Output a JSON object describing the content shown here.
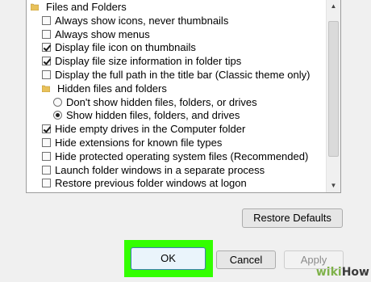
{
  "options_tree": {
    "items": [
      {
        "type": "folder",
        "indent": 0,
        "label": "Files and Folders"
      },
      {
        "type": "checkbox",
        "indent": 1,
        "checked": false,
        "label": "Always show icons, never thumbnails"
      },
      {
        "type": "checkbox",
        "indent": 1,
        "checked": false,
        "label": "Always show menus"
      },
      {
        "type": "checkbox",
        "indent": 1,
        "checked": true,
        "label": "Display file icon on thumbnails"
      },
      {
        "type": "checkbox",
        "indent": 1,
        "checked": true,
        "label": "Display file size information in folder tips"
      },
      {
        "type": "checkbox",
        "indent": 1,
        "checked": false,
        "label": "Display the full path in the title bar (Classic theme only)"
      },
      {
        "type": "folder",
        "indent": 1,
        "label": "Hidden files and folders"
      },
      {
        "type": "radio",
        "indent": 2,
        "checked": false,
        "label": "Don't show hidden files, folders, or drives"
      },
      {
        "type": "radio",
        "indent": 2,
        "checked": true,
        "label": "Show hidden files, folders, and drives"
      },
      {
        "type": "checkbox",
        "indent": 1,
        "checked": true,
        "label": "Hide empty drives in the Computer folder"
      },
      {
        "type": "checkbox",
        "indent": 1,
        "checked": false,
        "label": "Hide extensions for known file types"
      },
      {
        "type": "checkbox",
        "indent": 1,
        "checked": false,
        "label": "Hide protected operating system files (Recommended)"
      },
      {
        "type": "checkbox",
        "indent": 1,
        "checked": false,
        "label": "Launch folder windows in a separate process"
      },
      {
        "type": "checkbox",
        "indent": 1,
        "checked": false,
        "label": "Restore previous folder windows at logon"
      }
    ]
  },
  "buttons": {
    "restore_defaults": "Restore Defaults",
    "ok": "OK",
    "cancel": "Cancel",
    "apply": "Apply"
  },
  "highlight_color": "#33ff00",
  "watermark": {
    "part1": "wiki",
    "part2": "How"
  }
}
